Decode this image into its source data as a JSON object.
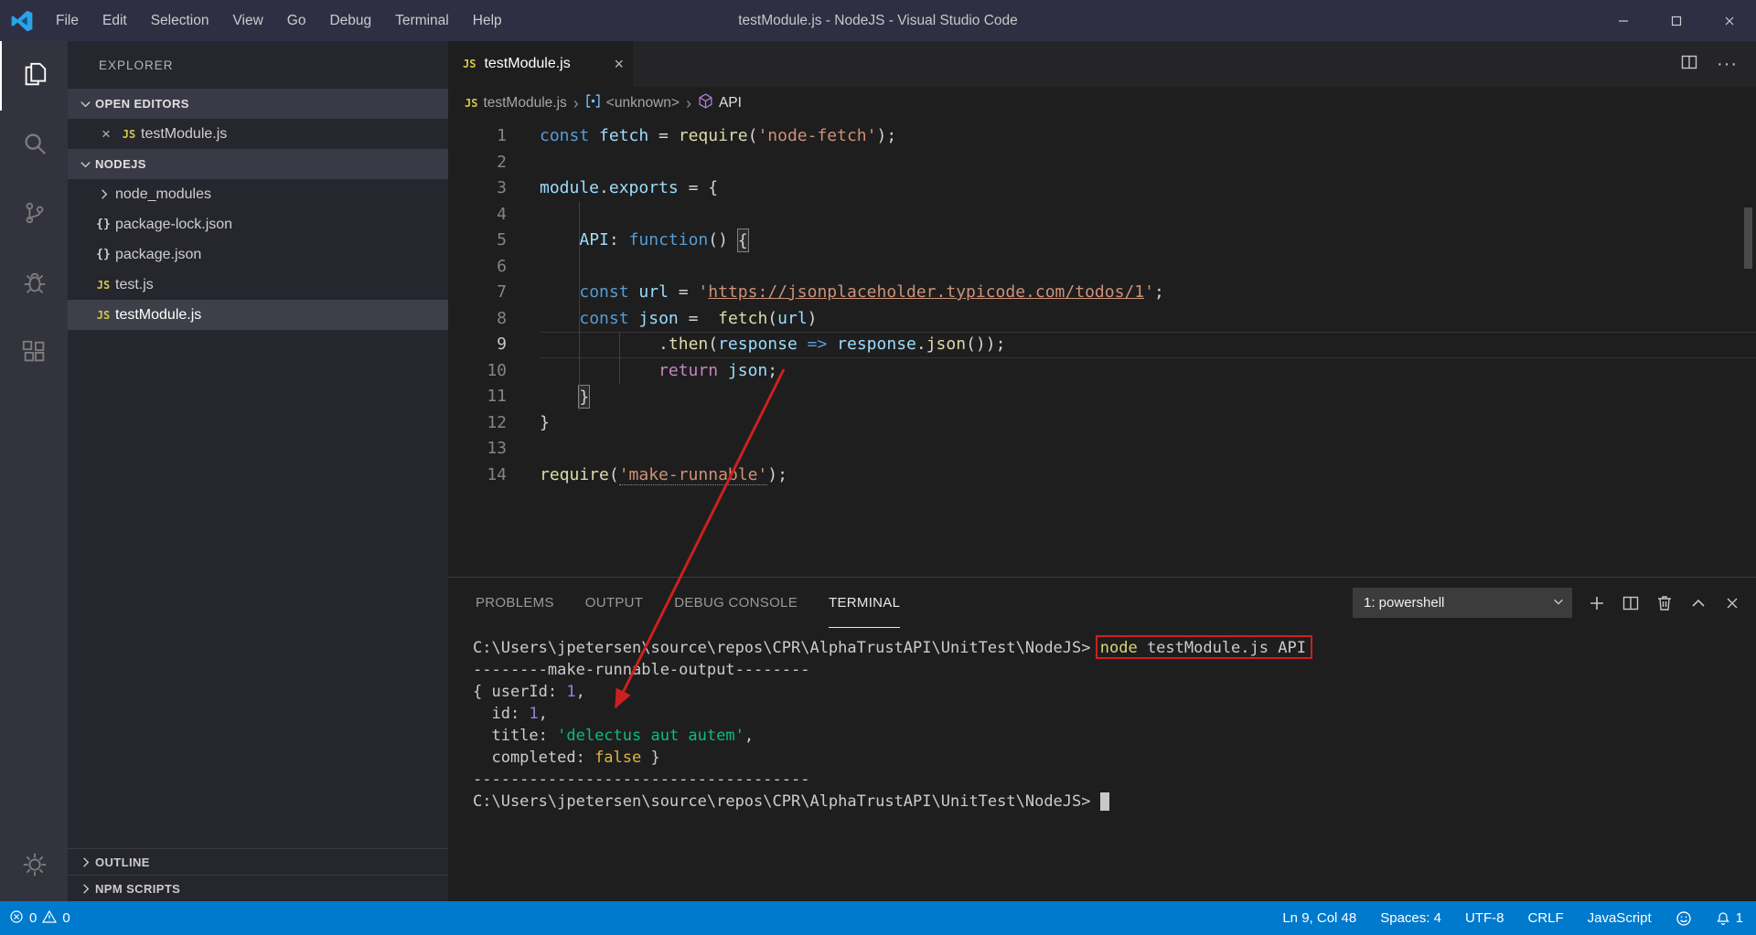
{
  "colors": {
    "accent_blue": "#007acc",
    "annotation_red": "#cc2020",
    "editor_bg": "#1e1e1e"
  },
  "window": {
    "title": "testModule.js - NodeJS - Visual Studio Code",
    "menu_items": [
      "File",
      "Edit",
      "Selection",
      "View",
      "Go",
      "Debug",
      "Terminal",
      "Help"
    ]
  },
  "activity_bar": {
    "items": [
      {
        "name": "explorer",
        "active": true
      },
      {
        "name": "search",
        "active": false
      },
      {
        "name": "source-control",
        "active": false
      },
      {
        "name": "debug",
        "active": false
      },
      {
        "name": "extensions",
        "active": false
      }
    ],
    "bottom_items": [
      {
        "name": "settings",
        "active": false
      }
    ]
  },
  "sidebar": {
    "header": "EXPLORER",
    "open_editors": {
      "label": "OPEN EDITORS",
      "items": [
        {
          "label": "testModule.js",
          "icon": "js"
        }
      ]
    },
    "project": {
      "label": "NODEJS",
      "items": [
        {
          "label": "node_modules",
          "icon": "chevron",
          "selected": false
        },
        {
          "label": "package-lock.json",
          "icon": "json",
          "selected": false
        },
        {
          "label": "package.json",
          "icon": "json",
          "selected": false
        },
        {
          "label": "test.js",
          "icon": "js",
          "selected": false
        },
        {
          "label": "testModule.js",
          "icon": "js",
          "selected": true
        }
      ]
    },
    "bottom_sections": [
      {
        "label": "OUTLINE"
      },
      {
        "label": "NPM SCRIPTS"
      }
    ]
  },
  "editor": {
    "tab": {
      "label": "testModule.js"
    },
    "breadcrumb": [
      {
        "label": "testModule.js",
        "icon": "js"
      },
      {
        "label": "<unknown>",
        "icon": "symbol-unknown"
      },
      {
        "label": "API",
        "icon": "symbol-module"
      }
    ],
    "code_lines": [
      {
        "n": 1,
        "t": [
          [
            "kw",
            "const"
          ],
          [
            "pl",
            " "
          ],
          [
            "var",
            "fetch"
          ],
          [
            "pl",
            " = "
          ],
          [
            "fn",
            "require"
          ],
          [
            "pl",
            "("
          ],
          [
            "str",
            "'node-fetch'"
          ],
          [
            "pl",
            ");"
          ]
        ]
      },
      {
        "n": 2,
        "t": []
      },
      {
        "n": 3,
        "t": [
          [
            "var",
            "module"
          ],
          [
            "pl",
            "."
          ],
          [
            "var",
            "exports"
          ],
          [
            "pl",
            " = {"
          ]
        ]
      },
      {
        "n": 4,
        "t": []
      },
      {
        "n": 5,
        "t": [
          [
            "pl",
            "    "
          ],
          [
            "var",
            "API"
          ],
          [
            "pl",
            ": "
          ],
          [
            "kw",
            "function"
          ],
          [
            "pl",
            "() "
          ],
          [
            "brk",
            "{"
          ]
        ]
      },
      {
        "n": 6,
        "t": []
      },
      {
        "n": 7,
        "t": [
          [
            "pl",
            "    "
          ],
          [
            "kw",
            "const"
          ],
          [
            "pl",
            " "
          ],
          [
            "var",
            "url"
          ],
          [
            "pl",
            " = "
          ],
          [
            "str",
            "'"
          ],
          [
            "strlink",
            "https://jsonplaceholder.typicode.com/todos/1"
          ],
          [
            "str",
            "'"
          ],
          [
            "pl",
            ";"
          ]
        ]
      },
      {
        "n": 8,
        "t": [
          [
            "pl",
            "    "
          ],
          [
            "kw",
            "const"
          ],
          [
            "pl",
            " "
          ],
          [
            "var",
            "json"
          ],
          [
            "pl",
            " =  "
          ],
          [
            "fn",
            "fetch"
          ],
          [
            "pl",
            "("
          ],
          [
            "var",
            "url"
          ],
          [
            "pl",
            ")"
          ]
        ]
      },
      {
        "n": 9,
        "cur": true,
        "t": [
          [
            "pl",
            "            ."
          ],
          [
            "fn",
            "then"
          ],
          [
            "pl",
            "("
          ],
          [
            "var",
            "response"
          ],
          [
            "pl",
            " "
          ],
          [
            "op",
            "=>"
          ],
          [
            "pl",
            " "
          ],
          [
            "var",
            "response"
          ],
          [
            "pl",
            "."
          ],
          [
            "fn",
            "json"
          ],
          [
            "pl",
            "());"
          ]
        ]
      },
      {
        "n": 10,
        "t": [
          [
            "pl",
            "            "
          ],
          [
            "ctrl",
            "return"
          ],
          [
            "pl",
            " "
          ],
          [
            "var",
            "json"
          ],
          [
            "pl",
            ";"
          ]
        ]
      },
      {
        "n": 11,
        "t": [
          [
            "pl",
            "    "
          ],
          [
            "brk",
            "}"
          ]
        ]
      },
      {
        "n": 12,
        "t": [
          [
            "pl",
            "}"
          ]
        ]
      },
      {
        "n": 13,
        "t": []
      },
      {
        "n": 14,
        "t": [
          [
            "fn",
            "require"
          ],
          [
            "pl",
            "("
          ],
          [
            "strdot",
            "'make-runnable'"
          ],
          [
            "pl",
            ");"
          ]
        ]
      }
    ]
  },
  "panel": {
    "tabs": [
      {
        "label": "PROBLEMS",
        "active": false
      },
      {
        "label": "OUTPUT",
        "active": false
      },
      {
        "label": "DEBUG CONSOLE",
        "active": false
      },
      {
        "label": "TERMINAL",
        "active": true
      }
    ],
    "shell_selector": "1: powershell",
    "terminal_lines": [
      {
        "t": [
          [
            "t",
            "C:\\Users\\jpetersen\\source\\repos\\CPR\\AlphaTrustAPI\\UnitTest\\NodeJS> "
          ],
          [
            "g:redbox",
            [
              [
                "cmd",
                "node"
              ],
              [
                "t",
                " testModule.js API"
              ]
            ]
          ]
        ]
      },
      {
        "t": [
          [
            "t",
            "--------make-runnable-output--------"
          ]
        ]
      },
      {
        "t": [
          [
            "t",
            "{ userId: "
          ],
          [
            "num",
            "1"
          ],
          [
            "t",
            ","
          ]
        ]
      },
      {
        "t": [
          [
            "t",
            "  id: "
          ],
          [
            "num",
            "1"
          ],
          [
            "t",
            ","
          ]
        ]
      },
      {
        "t": [
          [
            "t",
            "  title: "
          ],
          [
            "strg",
            "'delectus aut autem'"
          ],
          [
            "t",
            ","
          ]
        ]
      },
      {
        "t": [
          [
            "t",
            "  completed: "
          ],
          [
            "bool",
            "false"
          ],
          [
            "t",
            " }"
          ]
        ]
      },
      {
        "t": [
          [
            "t",
            "------------------------------------"
          ]
        ]
      },
      {
        "t": [
          [
            "t",
            "C:\\Users\\jpetersen\\source\\repos\\CPR\\AlphaTrustAPI\\UnitTest\\NodeJS> "
          ],
          [
            "cursor",
            ""
          ]
        ]
      }
    ]
  },
  "status_bar": {
    "errors": "0",
    "warnings": "0",
    "items": [
      "Ln 9, Col 48",
      "Spaces: 4",
      "UTF-8",
      "CRLF",
      "JavaScript"
    ],
    "notification_count": "1"
  }
}
